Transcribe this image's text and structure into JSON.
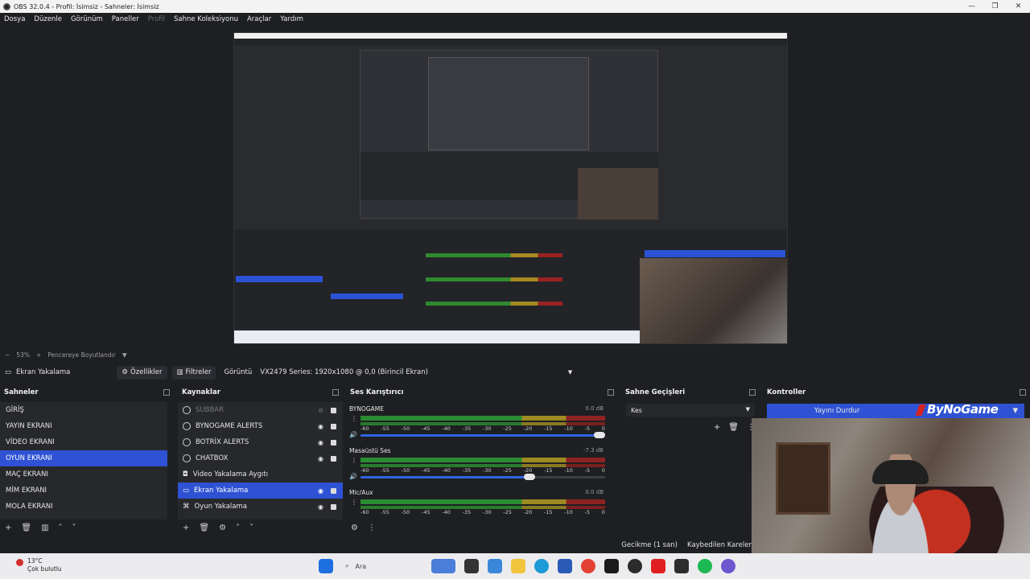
{
  "window": {
    "title": "OBS 32.0.4 - Profil: İsimsiz - Sahneler: İsimsiz"
  },
  "menu": [
    "Dosya",
    "Düzenle",
    "Görünüm",
    "Paneller",
    "Profil",
    "Sahne Koleksiyonu",
    "Araçlar",
    "Yardım"
  ],
  "zoom": {
    "level": "53%",
    "fit_label": "Pencereye Boyutlandır"
  },
  "source_bar": {
    "source_name": "Ekran Yakalama",
    "properties_label": "Özellikler",
    "filters_label": "Filtreler",
    "display_label": "Görüntü",
    "display_value": "VX2479 Series: 1920x1080 @ 0,0 (Birincil Ekran)"
  },
  "scenes": {
    "title": "Sahneler",
    "items": [
      "GİRİŞ",
      "YAYIN EKRANI",
      "VİDEO EKRANI",
      "OYUN EKRANI",
      "MAÇ EKRANI",
      "MİM EKRANI",
      "MOLA EKRANI"
    ],
    "selected": "OYUN EKRANI"
  },
  "sources": {
    "title": "Kaynaklar",
    "items": [
      "SUBBAR",
      "BYNOGAME ALERTS",
      "BOTRİX ALERTS",
      "CHATBOX",
      "Video Yakalama Aygıtı",
      "Ekran Yakalama",
      "Oyun Yakalama"
    ],
    "selected": "Ekran Yakalama"
  },
  "mixer": {
    "title": "Ses Karıştırıcı",
    "ticks": [
      "-60",
      "-55",
      "-50",
      "-45",
      "-40",
      "-35",
      "-30",
      "-25",
      "-20",
      "-15",
      "-10",
      "-5",
      "0"
    ],
    "channels": [
      {
        "name": "BYNOGAME",
        "db": "0.0 dB",
        "level": 1.0
      },
      {
        "name": "Masaüstü Ses",
        "db": "-7.3 dB",
        "level": 0.7
      },
      {
        "name": "Mic/Aux",
        "db": "0.0 dB",
        "level": 1.0
      }
    ]
  },
  "transitions": {
    "title": "Sahne Geçişleri",
    "value": "Kes"
  },
  "controls": {
    "title": "Kontroller",
    "stop_stream": "Yayını Durdur",
    "brand": "ByNoGame"
  },
  "status": {
    "delay": "Gecikme (1 san)",
    "dropped": "Kaybedilen Kareler"
  },
  "taskbar": {
    "weather_temp": "13°C",
    "weather_desc": "Çok bulutlu",
    "search": "Ara"
  },
  "colors": {
    "accent": "#2e52d3",
    "bg": "#1e1f22",
    "panel": "#27282c"
  }
}
